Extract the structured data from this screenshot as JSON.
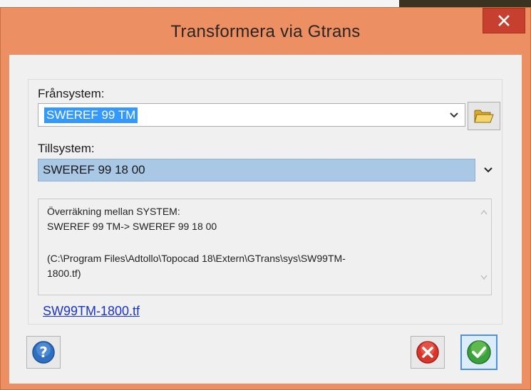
{
  "window": {
    "title": "Transformera via Gtrans",
    "close_label": "✕"
  },
  "from_system": {
    "label": "Frånsystem:",
    "value": "SWEREF 99 TM"
  },
  "to_system": {
    "label": "Tillsystem:",
    "value": "SWEREF 99 18 00"
  },
  "info": {
    "line1": "Överräkning mellan SYSTEM:",
    "line2": "SWEREF 99 TM-> SWEREF 99 18 00",
    "line3": "(C:\\Program Files\\Adtollo\\Topocad 18\\Extern\\GTrans\\sys\\SW99TM-",
    "line4": "1800.tf)"
  },
  "file_link": "SW99TM-1800.tf",
  "icons": {
    "folder": "folder-icon",
    "help": "help-icon",
    "cancel": "cancel-icon",
    "ok": "ok-icon"
  },
  "colors": {
    "title_bar": "#ec9063",
    "close_button": "#c7402f",
    "selection": "#3399ff",
    "combo_highlight": "#a9c8e6",
    "link": "#1a33cc"
  }
}
